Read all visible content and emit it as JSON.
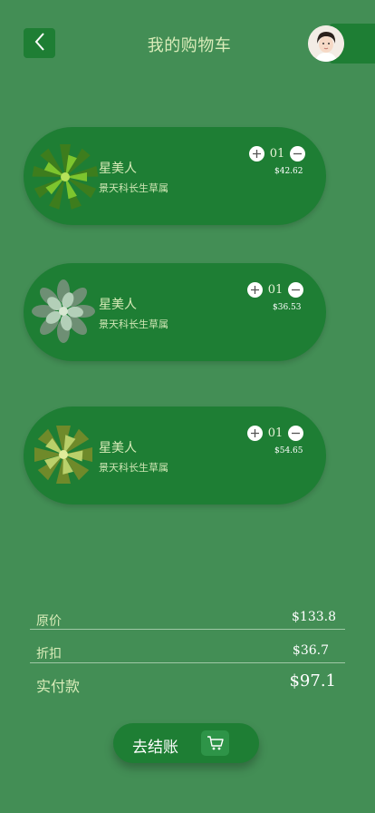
{
  "header": {
    "title": "我的购物车",
    "back_icon": "chevron-left-icon",
    "avatar": "user-avatar"
  },
  "colors": {
    "background": "#438e55",
    "card": "#1e7e34",
    "text": "#d9ecb9"
  },
  "cart_items": [
    {
      "name": "星美人",
      "desc": "景天科长生草属",
      "qty": "01",
      "price": "$42.62",
      "plant_color": "#5aa82a"
    },
    {
      "name": "星美人",
      "desc": "景天科长生草属",
      "qty": "01",
      "price": "$36.53",
      "plant_color": "#9ab8a0"
    },
    {
      "name": "星美人",
      "desc": "景天科长生草属",
      "qty": "01",
      "price": "$54.65",
      "plant_color": "#a4c25a"
    }
  ],
  "summary": {
    "original_label": "原价",
    "original_value": "$133.8",
    "discount_label": "折扣",
    "discount_value": "$36.7",
    "total_label": "实付款",
    "total_value": "$97.1"
  },
  "checkout": {
    "label": "去结账",
    "icon": "cart-icon"
  }
}
